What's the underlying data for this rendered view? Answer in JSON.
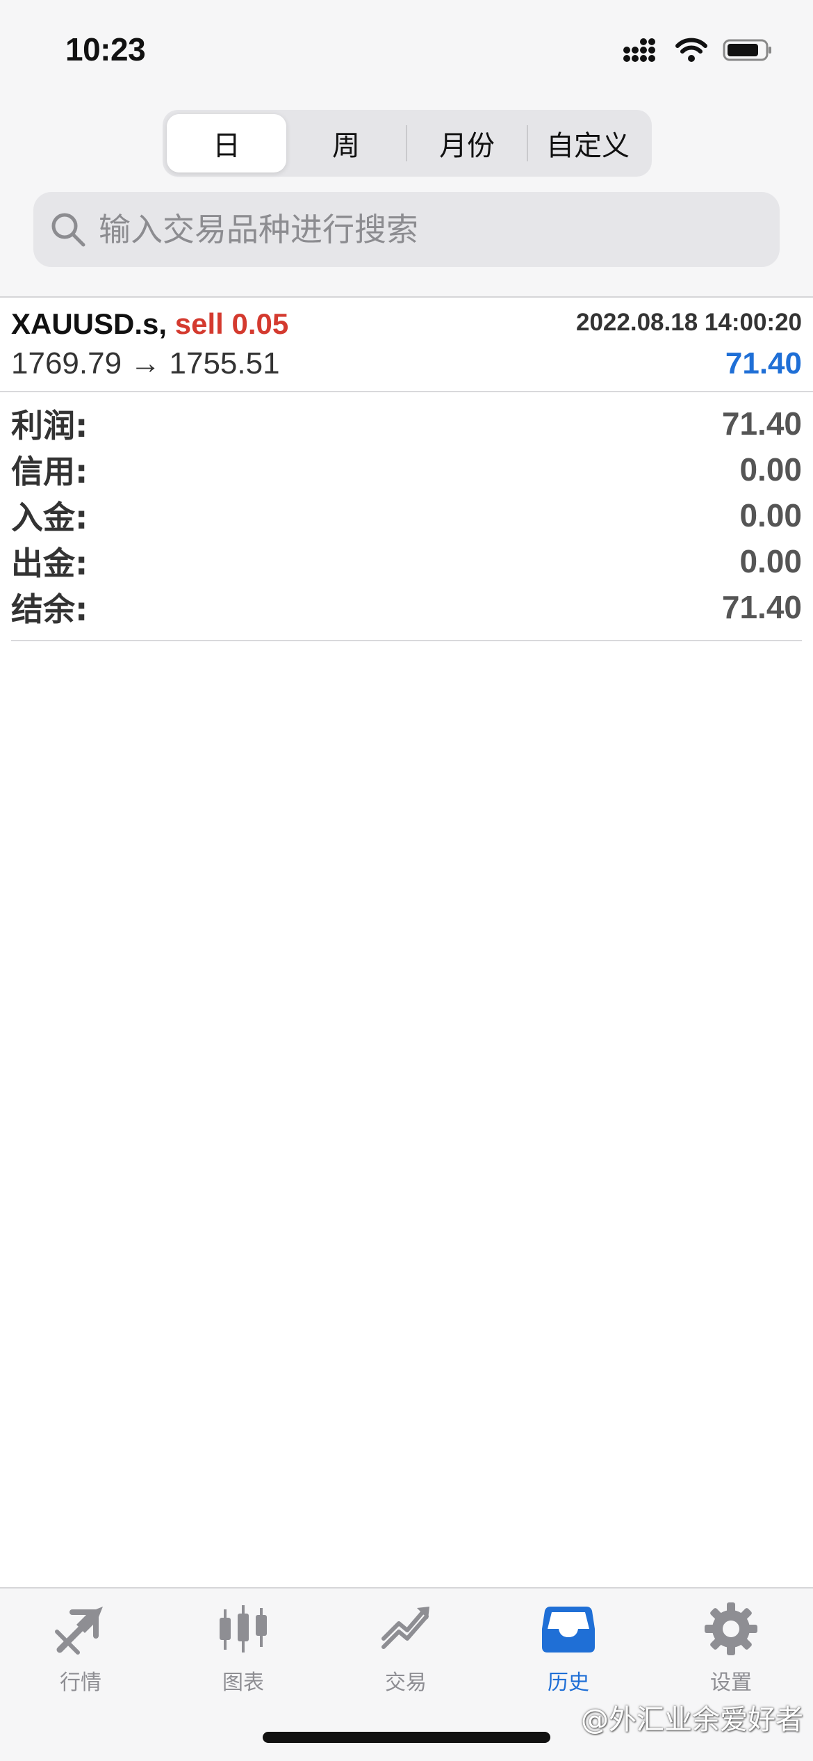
{
  "status_bar": {
    "time": "10:23"
  },
  "segments": [
    {
      "label": "日",
      "active": true
    },
    {
      "label": "周",
      "active": false
    },
    {
      "label": "月份",
      "active": false
    },
    {
      "label": "自定义",
      "active": false
    }
  ],
  "search": {
    "placeholder": "输入交易品种进行搜索"
  },
  "trade": {
    "symbol": "XAUUSD.s,",
    "side": "sell 0.05",
    "datetime": "2022.08.18 14:00:20",
    "prices": "1769.79 → 1755.51",
    "profit": "71.40"
  },
  "summary": [
    {
      "label": "利润:",
      "value": "71.40"
    },
    {
      "label": "信用:",
      "value": "0.00"
    },
    {
      "label": "入金:",
      "value": "0.00"
    },
    {
      "label": "出金:",
      "value": "0.00"
    },
    {
      "label": "结余:",
      "value": "71.40"
    }
  ],
  "tabs": [
    {
      "label": "行情",
      "icon": "quotes-icon",
      "active": false
    },
    {
      "label": "图表",
      "icon": "candlestick-chart-icon",
      "active": false
    },
    {
      "label": "交易",
      "icon": "trade-chart-icon",
      "active": false
    },
    {
      "label": "历史",
      "icon": "history-inbox-icon",
      "active": true
    },
    {
      "label": "设置",
      "icon": "gear-icon",
      "active": false
    }
  ],
  "watermark": "@外汇业余爱好者",
  "colors": {
    "accent": "#1f6fd6",
    "sell": "#d43a2f",
    "inactive": "#8e8e93"
  }
}
